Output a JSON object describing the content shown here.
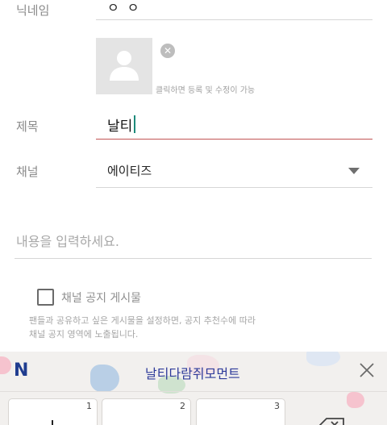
{
  "form": {
    "nickname_label": "닉네임",
    "nickname_value": "ㅇㅇ",
    "photo_hint": "클릭하면 등록 및 수정이 가능",
    "title_label": "제목",
    "title_value": "날티",
    "channel_label": "채널",
    "channel_value": "에이티즈",
    "content_placeholder": "내용을 입력하세요.",
    "notice_label": "채널 공지 게시물",
    "notice_help": "팬들과 공유하고 싶은 게시물을 설정하면, 공지 추천수에 따라 채널 공지 영역에 노출됩니다."
  },
  "keyboard": {
    "logo": "N",
    "suggestion": "날티다람쥐모먼트",
    "keys": [
      "1",
      "2",
      "3"
    ]
  },
  "colors": {
    "title_underline": "#c25555",
    "cursor": "#1d8a7b",
    "keyboard_logo": "#1f3c8f",
    "suggestion_text": "#2d3a9a"
  },
  "icons": {
    "photo_placeholder": "person-icon",
    "photo_delete": "close-circle-icon",
    "channel_dropdown": "caret-down-icon",
    "keyboard_close": "close-icon",
    "backspace": "backspace-icon"
  }
}
